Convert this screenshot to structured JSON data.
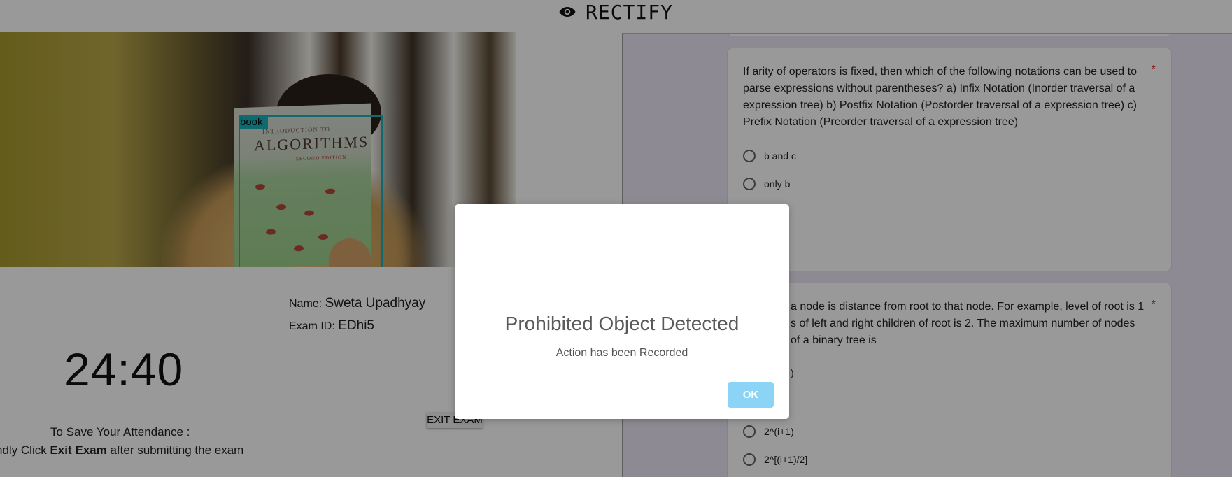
{
  "header": {
    "icon": "eye-icon",
    "brand": "RECTIFY"
  },
  "webcam": {
    "detection_label": "book",
    "book_title_small": "INTRODUCTION TO",
    "book_title": "ALGORITHMS",
    "book_subtitle": "SECOND EDITION"
  },
  "candidate": {
    "name_label": "Name:",
    "name_value": "Sweta Upadhyay",
    "exam_id_label": "Exam ID:",
    "exam_id_value": "EDhi5"
  },
  "timer": "24:40",
  "exit_button": "EXIT EXAM",
  "attendance": {
    "line1": "To Save Your Attendance :",
    "line2_prefix": "ndly Click ",
    "line2_bold": "Exit Exam",
    "line2_suffix": " after submitting the exam"
  },
  "form": {
    "questions": [
      {
        "text": "If arity of operators is fixed, then which of the following notations can be used to parse expressions without parentheses? a) Infix Notation (Inorder traversal of a expression tree) b) Postfix Notation (Postorder traversal of a expression tree) c) Prefix Notation (Preorder traversal of a expression tree)",
        "required_mark": "*",
        "options": [
          "b and c",
          "only b"
        ]
      },
      {
        "text_visible": "a node is distance from root to that node. For example, level of root is 1 s of left and right children of root is 2. The maximum number of nodes of a binary tree is",
        "line1": "a node is distance from root to that node. For example, level of root is 1",
        "line2": "s of left and right children of root is 2. The maximum number of nodes",
        "line3": "of a binary tree is",
        "required_mark": "*",
        "partial_option": ")",
        "options": [
          "2^(i+1)",
          "2^[(i+1)/2]"
        ]
      }
    ]
  },
  "modal": {
    "title": "Prohibited Object Detected",
    "text": "Action has been Recorded",
    "ok_label": "OK"
  },
  "colors": {
    "detection": "#18b1b8",
    "ok_button": "#8cd4f5",
    "form_bg": "#ede7f6",
    "required": "#d93025"
  }
}
